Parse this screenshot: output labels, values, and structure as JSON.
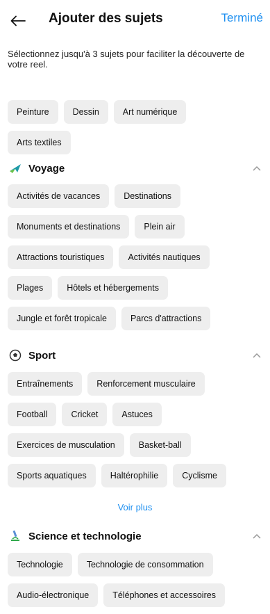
{
  "header": {
    "title": "Ajouter des sujets",
    "done_label": "Terminé"
  },
  "intro": "Sélectionnez jusqu'à 3 sujets pour faciliter la découverte de votre reel.",
  "art_topics": [
    [
      "Peinture",
      "Dessin",
      "Art numérique"
    ],
    [
      "Arts textiles"
    ]
  ],
  "sections": {
    "voyage": {
      "label": "Voyage",
      "icon": "airplane-icon",
      "rows": [
        [
          "Activités de vacances",
          "Destinations"
        ],
        [
          "Monuments et destinations",
          "Plein air"
        ],
        [
          "Attractions touristiques",
          "Activités nautiques"
        ],
        [
          "Plages",
          "Hôtels et hébergements"
        ],
        [
          "Jungle et forêt tropicale",
          "Parcs d'attractions"
        ]
      ]
    },
    "sport": {
      "label": "Sport",
      "icon": "soccer-ball-icon",
      "rows": [
        [
          "Entraînements",
          "Renforcement musculaire"
        ],
        [
          "Football",
          "Cricket",
          "Astuces"
        ],
        [
          "Exercices de musculation",
          "Basket-ball"
        ],
        [
          "Sports aquatiques",
          "Haltérophilie",
          "Cyclisme"
        ]
      ],
      "see_more": "Voir plus"
    },
    "science": {
      "label": "Science et technologie",
      "icon": "microscope-icon",
      "rows": [
        [
          "Technologie",
          "Technologie de consommation"
        ],
        [
          "Audio-électronique",
          "Téléphones et accessoires"
        ]
      ]
    }
  },
  "colors": {
    "accent": "#1d8ff0",
    "chip_bg": "#eeeeee"
  }
}
